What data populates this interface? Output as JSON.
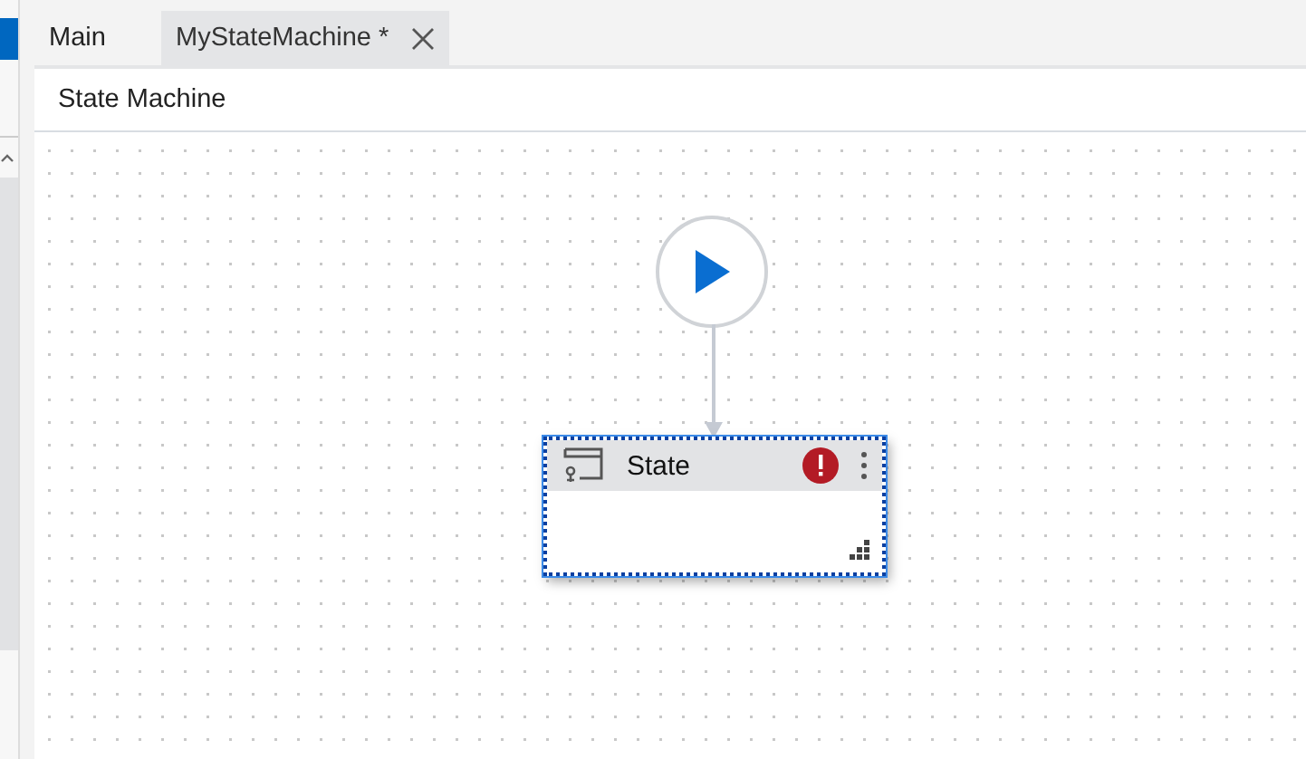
{
  "tabs": [
    {
      "label": "Main",
      "selected": false,
      "closable": false
    },
    {
      "label": "MyStateMachine *",
      "selected": true,
      "closable": true
    }
  ],
  "designer": {
    "title": "State Machine"
  },
  "states": [
    {
      "label": "State",
      "kind": "state",
      "selected": true,
      "has_error": true
    }
  ]
}
